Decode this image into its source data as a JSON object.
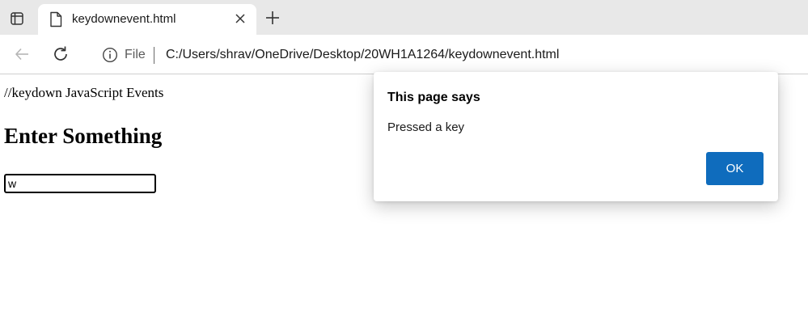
{
  "browser": {
    "tab": {
      "title": "keydownevent.html",
      "icon": "page-icon"
    },
    "icons": {
      "tab_actions": "tab-actions-icon",
      "close": "close-icon",
      "new_tab": "plus-icon",
      "back": "back-arrow-icon",
      "refresh": "refresh-icon",
      "site_info": "info-icon"
    },
    "address": {
      "scheme_label": "File",
      "url": "C:/Users/shrav/OneDrive/Desktop/20WH1A1264/keydownevent.html"
    }
  },
  "page": {
    "comment_text": "//keydown JavaScript Events",
    "heading": "Enter Something",
    "input_value": "w"
  },
  "dialog": {
    "title": "This page says",
    "message": "Pressed a key",
    "ok_label": "OK"
  },
  "colors": {
    "tabstrip_bg": "#e8e8e8",
    "accent_button": "#0f6cbd"
  }
}
